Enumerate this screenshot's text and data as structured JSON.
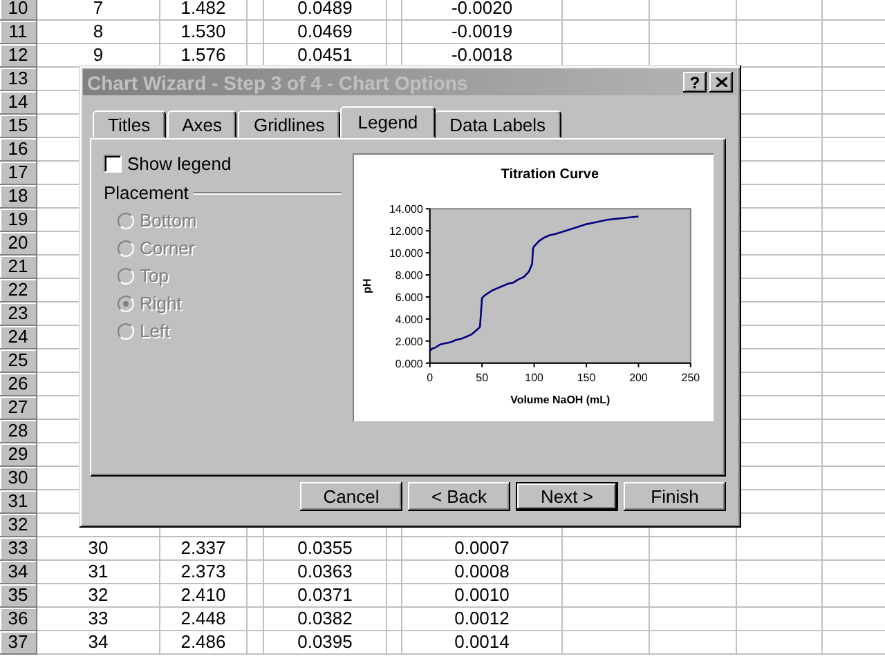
{
  "sheet": {
    "rows": [
      {
        "number": "10",
        "cells": [
          "7",
          "1.482",
          "0.0489",
          "-0.0020"
        ]
      },
      {
        "number": "11",
        "cells": [
          "8",
          "1.530",
          "0.0469",
          "-0.0019"
        ]
      },
      {
        "number": "12",
        "cells": [
          "9",
          "1.576",
          "0.0451",
          "-0.0018"
        ]
      },
      {
        "number": "13"
      },
      {
        "number": "14"
      },
      {
        "number": "15"
      },
      {
        "number": "16"
      },
      {
        "number": "17"
      },
      {
        "number": "18"
      },
      {
        "number": "19"
      },
      {
        "number": "20"
      },
      {
        "number": "21"
      },
      {
        "number": "22"
      },
      {
        "number": "23"
      },
      {
        "number": "24"
      },
      {
        "number": "25"
      },
      {
        "number": "26"
      },
      {
        "number": "27"
      },
      {
        "number": "28"
      },
      {
        "number": "29"
      },
      {
        "number": "30"
      },
      {
        "number": "31"
      },
      {
        "number": "32"
      },
      {
        "number": "33",
        "cells": [
          "30",
          "2.337",
          "0.0355",
          "0.0007"
        ]
      },
      {
        "number": "34",
        "cells": [
          "31",
          "2.373",
          "0.0363",
          "0.0008"
        ]
      },
      {
        "number": "35",
        "cells": [
          "32",
          "2.410",
          "0.0371",
          "0.0010"
        ]
      },
      {
        "number": "36",
        "cells": [
          "33",
          "2.448",
          "0.0382",
          "0.0012"
        ]
      },
      {
        "number": "37",
        "cells": [
          "34",
          "2.486",
          "0.0395",
          "0.0014"
        ]
      }
    ]
  },
  "dialog": {
    "title": "Chart Wizard - Step 3 of 4 - Chart Options",
    "help_button": "?",
    "tabs": [
      {
        "label": "Titles",
        "selected": false
      },
      {
        "label": "Axes",
        "selected": false
      },
      {
        "label": "Gridlines",
        "selected": false
      },
      {
        "label": "Legend",
        "selected": true
      },
      {
        "label": "Data Labels",
        "selected": false
      }
    ],
    "show_legend": {
      "label": "Show legend",
      "checked": false
    },
    "placement": {
      "label": "Placement",
      "options": [
        {
          "label": "Bottom",
          "selected": false,
          "disabled": true
        },
        {
          "label": "Corner",
          "selected": false,
          "disabled": true
        },
        {
          "label": "Top",
          "selected": false,
          "disabled": true
        },
        {
          "label": "Right",
          "selected": true,
          "disabled": true
        },
        {
          "label": "Left",
          "selected": false,
          "disabled": true
        }
      ]
    },
    "preview": {
      "chart_data": {
        "type": "line",
        "title": "Titration Curve",
        "xlabel": "Volume NaOH (mL)",
        "ylabel": "pH",
        "x": [
          0,
          2,
          5,
          10,
          15,
          20,
          25,
          30,
          35,
          40,
          45,
          48,
          49,
          50,
          52,
          55,
          60,
          65,
          70,
          75,
          80,
          85,
          90,
          95,
          98,
          99,
          100,
          105,
          110,
          115,
          120,
          130,
          140,
          150,
          160,
          170,
          180,
          190,
          200
        ],
        "series": [
          {
            "color": "#000080",
            "values": [
              1.1,
              1.3,
              1.4,
              1.7,
              1.8,
              1.9,
              2.1,
              2.2,
              2.4,
              2.6,
              3.0,
              3.3,
              4.5,
              5.9,
              6.1,
              6.3,
              6.6,
              6.8,
              7.0,
              7.2,
              7.3,
              7.6,
              7.8,
              8.3,
              9.0,
              10.4,
              10.6,
              11.1,
              11.4,
              11.6,
              11.7,
              12.0,
              12.3,
              12.6,
              12.8,
              13.0,
              13.1,
              13.2,
              13.3
            ]
          }
        ],
        "xlim": [
          0,
          250
        ],
        "ylim": [
          0,
          14
        ],
        "xticks": [
          0,
          50,
          100,
          150,
          200,
          250
        ],
        "yticks": [
          {
            "value": 0,
            "label": "0.000"
          },
          {
            "value": 2,
            "label": "2.000"
          },
          {
            "value": 4,
            "label": "4.000"
          },
          {
            "value": 6,
            "label": "6.000"
          },
          {
            "value": 8,
            "label": "8.000"
          },
          {
            "value": 10,
            "label": "10.000"
          },
          {
            "value": 12,
            "label": "12.000"
          },
          {
            "value": 14,
            "label": "14.000"
          }
        ]
      }
    },
    "buttons": [
      {
        "label": "Cancel",
        "default": false
      },
      {
        "label": "< Back",
        "default": false
      },
      {
        "label": "Next >",
        "default": true
      },
      {
        "label": "Finish",
        "default": false
      }
    ]
  }
}
